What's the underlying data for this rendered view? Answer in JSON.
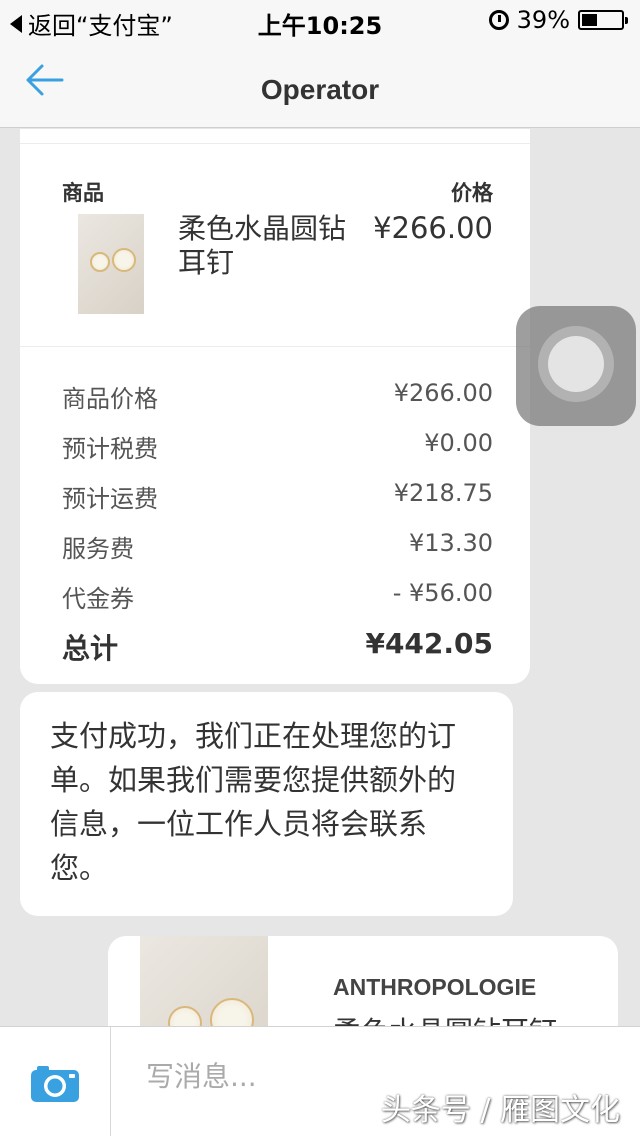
{
  "status_bar": {
    "back_app": "返回“支付宝”",
    "time": "上午10:25",
    "battery": "39%",
    "battery_level": 0.39
  },
  "nav": {
    "title": "Operator",
    "back_icon": "arrow-left-icon"
  },
  "order": {
    "col_item": "商品",
    "col_price": "价格",
    "product_name": "柔色水晶圆钻耳钉",
    "product_price": "¥266.00",
    "summary": [
      {
        "label": "商品价格",
        "value": "¥266.00"
      },
      {
        "label": "预计税费",
        "value": "¥0.00"
      },
      {
        "label": "预计运费",
        "value": "¥218.75"
      },
      {
        "label": "服务费",
        "value": "¥13.30"
      },
      {
        "label": "代金券",
        "value": "- ¥56.00"
      }
    ],
    "total_label": "总计",
    "total_value": "¥442.05"
  },
  "message": {
    "text": "支付成功，我们正在处理您的订单。如果我们需要您提供额外的信息，一位工作人员将会联系您。"
  },
  "product_card": {
    "brand": "ANTHROPOLOGIE",
    "name": "柔色水晶圆钻耳钉"
  },
  "input": {
    "placeholder": "写消息...",
    "camera_icon": "camera-icon"
  },
  "watermark": "头条号 / 雁图文化",
  "colors": {
    "accent": "#3aa1e0",
    "background": "#e6e6e6"
  }
}
